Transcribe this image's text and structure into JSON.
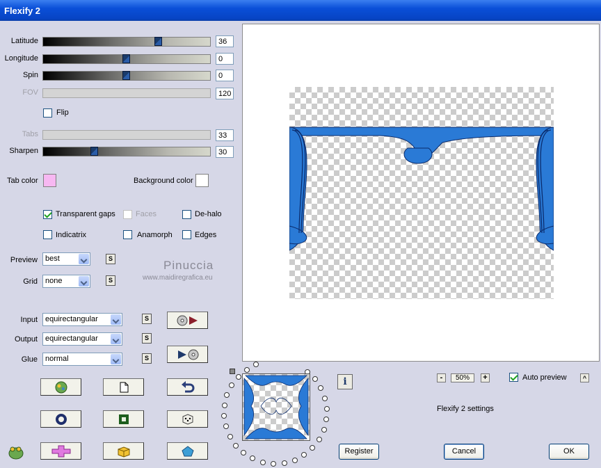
{
  "window": {
    "title": "Flexify 2"
  },
  "sliders": {
    "latitude": {
      "label": "Latitude",
      "value": "36"
    },
    "longitude": {
      "label": "Longitude",
      "value": "0"
    },
    "spin": {
      "label": "Spin",
      "value": "0"
    },
    "fov": {
      "label": "FOV",
      "value": "120"
    },
    "tabs": {
      "label": "Tabs",
      "value": "33"
    },
    "sharpen": {
      "label": "Sharpen",
      "value": "30"
    }
  },
  "flip": {
    "label": "Flip",
    "checked": false
  },
  "colors": {
    "tab_color": {
      "label": "Tab color",
      "value": "#f7b8f2"
    },
    "background_color": {
      "label": "Background color",
      "value": "#ffffff"
    }
  },
  "options": {
    "transparent_gaps": {
      "label": "Transparent gaps",
      "checked": true
    },
    "faces": {
      "label": "Faces",
      "checked": false
    },
    "de_halo": {
      "label": "De-halo",
      "checked": false
    },
    "indicatrix": {
      "label": "Indicatrix",
      "checked": false
    },
    "anamorph": {
      "label": "Anamorph",
      "checked": false
    },
    "edges": {
      "label": "Edges",
      "checked": false
    }
  },
  "preview_select": {
    "label": "Preview",
    "value": "best"
  },
  "grid_select": {
    "label": "Grid",
    "value": "none"
  },
  "input_select": {
    "label": "Input",
    "value": "equirectangular"
  },
  "output_select": {
    "label": "Output",
    "value": "equirectangular"
  },
  "glue_select": {
    "label": "Glue",
    "value": "normal"
  },
  "s_button_label": "S",
  "watermark": {
    "name": "Pinuccia",
    "url": "www.maidiregrafica.eu"
  },
  "zoom": {
    "minus": "-",
    "value": "50%",
    "plus": "+"
  },
  "auto_preview": {
    "label": "Auto preview",
    "checked": true
  },
  "collapse_label": "^",
  "settings_label": "Flexify 2 settings",
  "info_label": "i",
  "buttons": {
    "register": "Register",
    "cancel": "Cancel",
    "ok": "OK"
  },
  "accent_blue": "#2a7ad6"
}
